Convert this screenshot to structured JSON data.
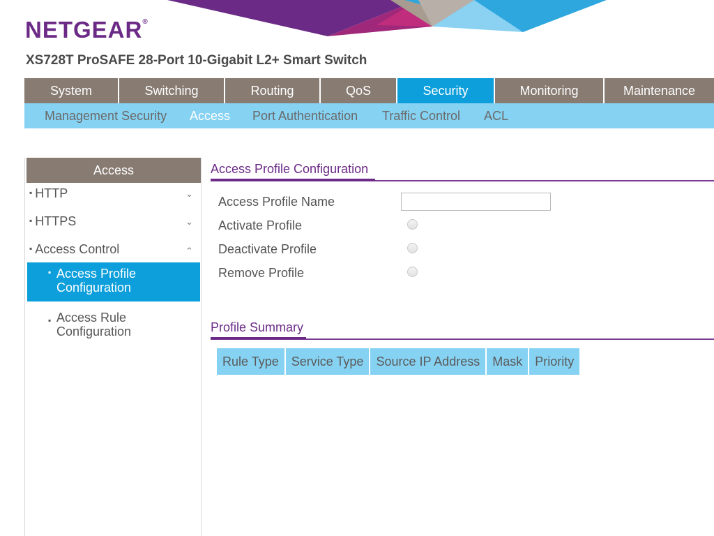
{
  "brand": {
    "logo_text": "NETGEAR",
    "logo_mark": "®",
    "product_title": "XS728T ProSAFE 28-Port 10-Gigabit L2+ Smart Switch",
    "colors": {
      "purple": "#6b2a86",
      "nav_gray": "#877b72",
      "active_blue": "#0d9fdb",
      "light_blue": "#86d2f3"
    }
  },
  "main_nav": {
    "tabs": [
      {
        "label": "System",
        "active": false
      },
      {
        "label": "Switching",
        "active": false
      },
      {
        "label": "Routing",
        "active": false
      },
      {
        "label": "QoS",
        "active": false
      },
      {
        "label": "Security",
        "active": true
      },
      {
        "label": "Monitoring",
        "active": false
      },
      {
        "label": "Maintenance",
        "active": false
      }
    ]
  },
  "sub_nav": {
    "items": [
      {
        "label": "Management Security",
        "active": false
      },
      {
        "label": "Access",
        "active": true
      },
      {
        "label": "Port Authentication",
        "active": false
      },
      {
        "label": "Traffic Control",
        "active": false
      },
      {
        "label": "ACL",
        "active": false
      }
    ]
  },
  "sidebar": {
    "heading": "Access",
    "bullet": "▪",
    "items": [
      {
        "label": "HTTP",
        "icon": "chevron-down-icon",
        "glyph": "⌄"
      },
      {
        "label": "HTTPS",
        "icon": "chevron-down-icon",
        "glyph": "⌄"
      },
      {
        "label": "Access Control",
        "icon": "chevron-up-icon",
        "glyph": "⌃"
      }
    ],
    "sub_items": [
      {
        "line1": "Access Profile",
        "line2": "Configuration",
        "active": true
      },
      {
        "line1": "Access Rule",
        "line2": "Configuration",
        "active": false
      }
    ]
  },
  "profile_config": {
    "title": "Access Profile Configuration",
    "name_label": "Access Profile Name",
    "name_value": "",
    "activate_label": "Activate Profile",
    "deactivate_label": "Deactivate Profile",
    "remove_label": "Remove Profile"
  },
  "profile_summary": {
    "title": "Profile Summary",
    "columns": [
      "Rule Type",
      "Service Type",
      "Source IP Address",
      "Mask",
      "Priority"
    ]
  }
}
